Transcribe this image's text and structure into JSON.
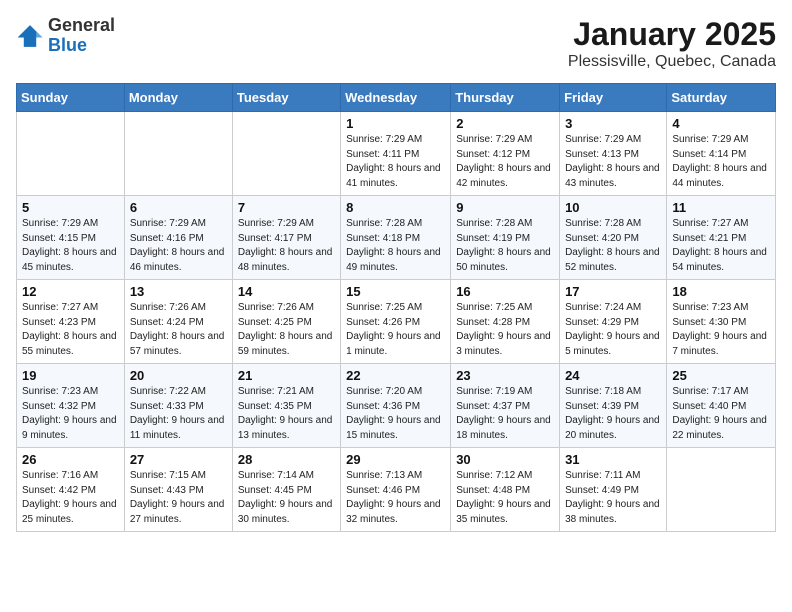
{
  "header": {
    "logo_general": "General",
    "logo_blue": "Blue",
    "title": "January 2025",
    "subtitle": "Plessisville, Quebec, Canada"
  },
  "weekdays": [
    "Sunday",
    "Monday",
    "Tuesday",
    "Wednesday",
    "Thursday",
    "Friday",
    "Saturday"
  ],
  "weeks": [
    [
      {
        "day": "",
        "info": ""
      },
      {
        "day": "",
        "info": ""
      },
      {
        "day": "",
        "info": ""
      },
      {
        "day": "1",
        "info": "Sunrise: 7:29 AM\nSunset: 4:11 PM\nDaylight: 8 hours and 41 minutes."
      },
      {
        "day": "2",
        "info": "Sunrise: 7:29 AM\nSunset: 4:12 PM\nDaylight: 8 hours and 42 minutes."
      },
      {
        "day": "3",
        "info": "Sunrise: 7:29 AM\nSunset: 4:13 PM\nDaylight: 8 hours and 43 minutes."
      },
      {
        "day": "4",
        "info": "Sunrise: 7:29 AM\nSunset: 4:14 PM\nDaylight: 8 hours and 44 minutes."
      }
    ],
    [
      {
        "day": "5",
        "info": "Sunrise: 7:29 AM\nSunset: 4:15 PM\nDaylight: 8 hours and 45 minutes."
      },
      {
        "day": "6",
        "info": "Sunrise: 7:29 AM\nSunset: 4:16 PM\nDaylight: 8 hours and 46 minutes."
      },
      {
        "day": "7",
        "info": "Sunrise: 7:29 AM\nSunset: 4:17 PM\nDaylight: 8 hours and 48 minutes."
      },
      {
        "day": "8",
        "info": "Sunrise: 7:28 AM\nSunset: 4:18 PM\nDaylight: 8 hours and 49 minutes."
      },
      {
        "day": "9",
        "info": "Sunrise: 7:28 AM\nSunset: 4:19 PM\nDaylight: 8 hours and 50 minutes."
      },
      {
        "day": "10",
        "info": "Sunrise: 7:28 AM\nSunset: 4:20 PM\nDaylight: 8 hours and 52 minutes."
      },
      {
        "day": "11",
        "info": "Sunrise: 7:27 AM\nSunset: 4:21 PM\nDaylight: 8 hours and 54 minutes."
      }
    ],
    [
      {
        "day": "12",
        "info": "Sunrise: 7:27 AM\nSunset: 4:23 PM\nDaylight: 8 hours and 55 minutes."
      },
      {
        "day": "13",
        "info": "Sunrise: 7:26 AM\nSunset: 4:24 PM\nDaylight: 8 hours and 57 minutes."
      },
      {
        "day": "14",
        "info": "Sunrise: 7:26 AM\nSunset: 4:25 PM\nDaylight: 8 hours and 59 minutes."
      },
      {
        "day": "15",
        "info": "Sunrise: 7:25 AM\nSunset: 4:26 PM\nDaylight: 9 hours and 1 minute."
      },
      {
        "day": "16",
        "info": "Sunrise: 7:25 AM\nSunset: 4:28 PM\nDaylight: 9 hours and 3 minutes."
      },
      {
        "day": "17",
        "info": "Sunrise: 7:24 AM\nSunset: 4:29 PM\nDaylight: 9 hours and 5 minutes."
      },
      {
        "day": "18",
        "info": "Sunrise: 7:23 AM\nSunset: 4:30 PM\nDaylight: 9 hours and 7 minutes."
      }
    ],
    [
      {
        "day": "19",
        "info": "Sunrise: 7:23 AM\nSunset: 4:32 PM\nDaylight: 9 hours and 9 minutes."
      },
      {
        "day": "20",
        "info": "Sunrise: 7:22 AM\nSunset: 4:33 PM\nDaylight: 9 hours and 11 minutes."
      },
      {
        "day": "21",
        "info": "Sunrise: 7:21 AM\nSunset: 4:35 PM\nDaylight: 9 hours and 13 minutes."
      },
      {
        "day": "22",
        "info": "Sunrise: 7:20 AM\nSunset: 4:36 PM\nDaylight: 9 hours and 15 minutes."
      },
      {
        "day": "23",
        "info": "Sunrise: 7:19 AM\nSunset: 4:37 PM\nDaylight: 9 hours and 18 minutes."
      },
      {
        "day": "24",
        "info": "Sunrise: 7:18 AM\nSunset: 4:39 PM\nDaylight: 9 hours and 20 minutes."
      },
      {
        "day": "25",
        "info": "Sunrise: 7:17 AM\nSunset: 4:40 PM\nDaylight: 9 hours and 22 minutes."
      }
    ],
    [
      {
        "day": "26",
        "info": "Sunrise: 7:16 AM\nSunset: 4:42 PM\nDaylight: 9 hours and 25 minutes."
      },
      {
        "day": "27",
        "info": "Sunrise: 7:15 AM\nSunset: 4:43 PM\nDaylight: 9 hours and 27 minutes."
      },
      {
        "day": "28",
        "info": "Sunrise: 7:14 AM\nSunset: 4:45 PM\nDaylight: 9 hours and 30 minutes."
      },
      {
        "day": "29",
        "info": "Sunrise: 7:13 AM\nSunset: 4:46 PM\nDaylight: 9 hours and 32 minutes."
      },
      {
        "day": "30",
        "info": "Sunrise: 7:12 AM\nSunset: 4:48 PM\nDaylight: 9 hours and 35 minutes."
      },
      {
        "day": "31",
        "info": "Sunrise: 7:11 AM\nSunset: 4:49 PM\nDaylight: 9 hours and 38 minutes."
      },
      {
        "day": "",
        "info": ""
      }
    ]
  ]
}
